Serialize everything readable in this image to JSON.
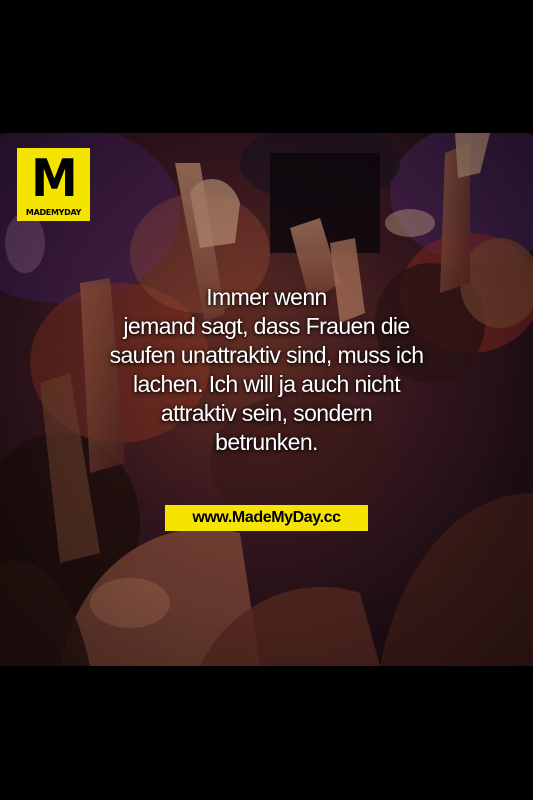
{
  "logo": {
    "letter": "M",
    "brand": "MADEMYDAY"
  },
  "quote": {
    "lines": [
      "Immer wenn",
      "jemand sagt, dass Frauen die",
      "saufen unattraktiv sind, muss ich",
      "lachen. Ich will ja auch nicht",
      "attraktiv sein, sondern",
      "betrunken."
    ]
  },
  "website": "www.MadeMyDay.cc",
  "colors": {
    "background": "#000000",
    "accent_yellow": "#f5e400",
    "text": "#ffffff"
  }
}
